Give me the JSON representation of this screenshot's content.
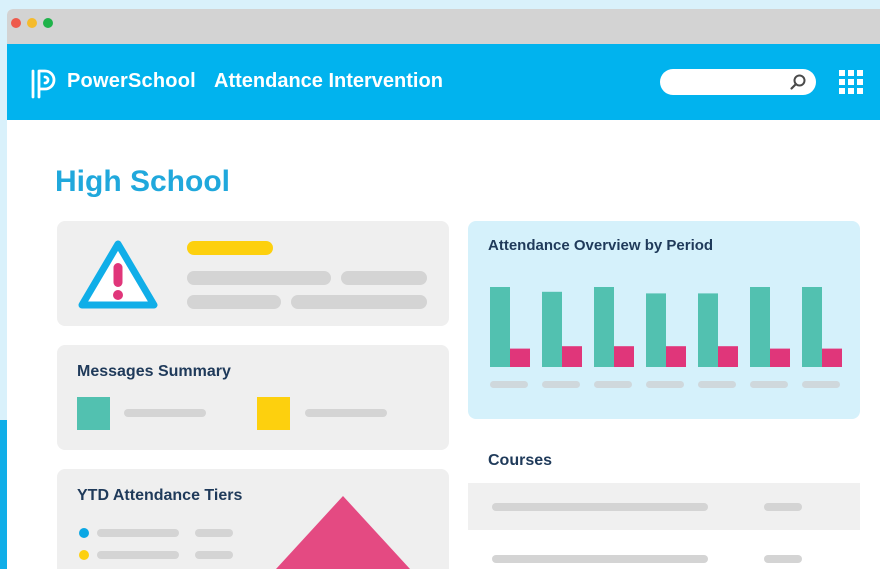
{
  "window": {
    "controls": [
      "close",
      "minimize",
      "maximize"
    ]
  },
  "header": {
    "brand": "PowerSchool",
    "app_title": "Attendance Intervention",
    "search_placeholder": "",
    "search_icon": "search-icon",
    "apps_icon": "grid-apps-icon"
  },
  "page": {
    "title": "High School"
  },
  "alert_card": {
    "icon": "warning-triangle-icon"
  },
  "messages_summary": {
    "title": "Messages Summary",
    "legend_colors": [
      "#52c1b0",
      "#fdd00e"
    ]
  },
  "ytd_tiers": {
    "title": "YTD Attendance Tiers",
    "dot_colors": [
      "#0aa7e4",
      "#fdd00e"
    ]
  },
  "attendance_overview": {
    "title": "Attendance Overview by Period"
  },
  "chart_data": {
    "type": "bar",
    "title": "Attendance Overview by Period",
    "categories": [
      "",
      "",
      "",
      "",
      "",
      "",
      ""
    ],
    "series": [
      {
        "values": [
          100,
          94,
          100,
          92,
          92,
          100,
          100
        ],
        "color": "#52c1b0"
      },
      {
        "values": [
          23,
          26,
          26,
          26,
          26,
          23,
          23
        ],
        "color": "#e0367a"
      }
    ],
    "ylim": [
      0,
      100
    ],
    "grid": false,
    "legend": "none"
  },
  "courses": {
    "title": "Courses"
  },
  "colors": {
    "accent": "#01b3ee",
    "title_blue": "#20a8dc",
    "teal": "#52c1b0",
    "pink": "#e0367a",
    "yellow": "#fdd00e"
  }
}
